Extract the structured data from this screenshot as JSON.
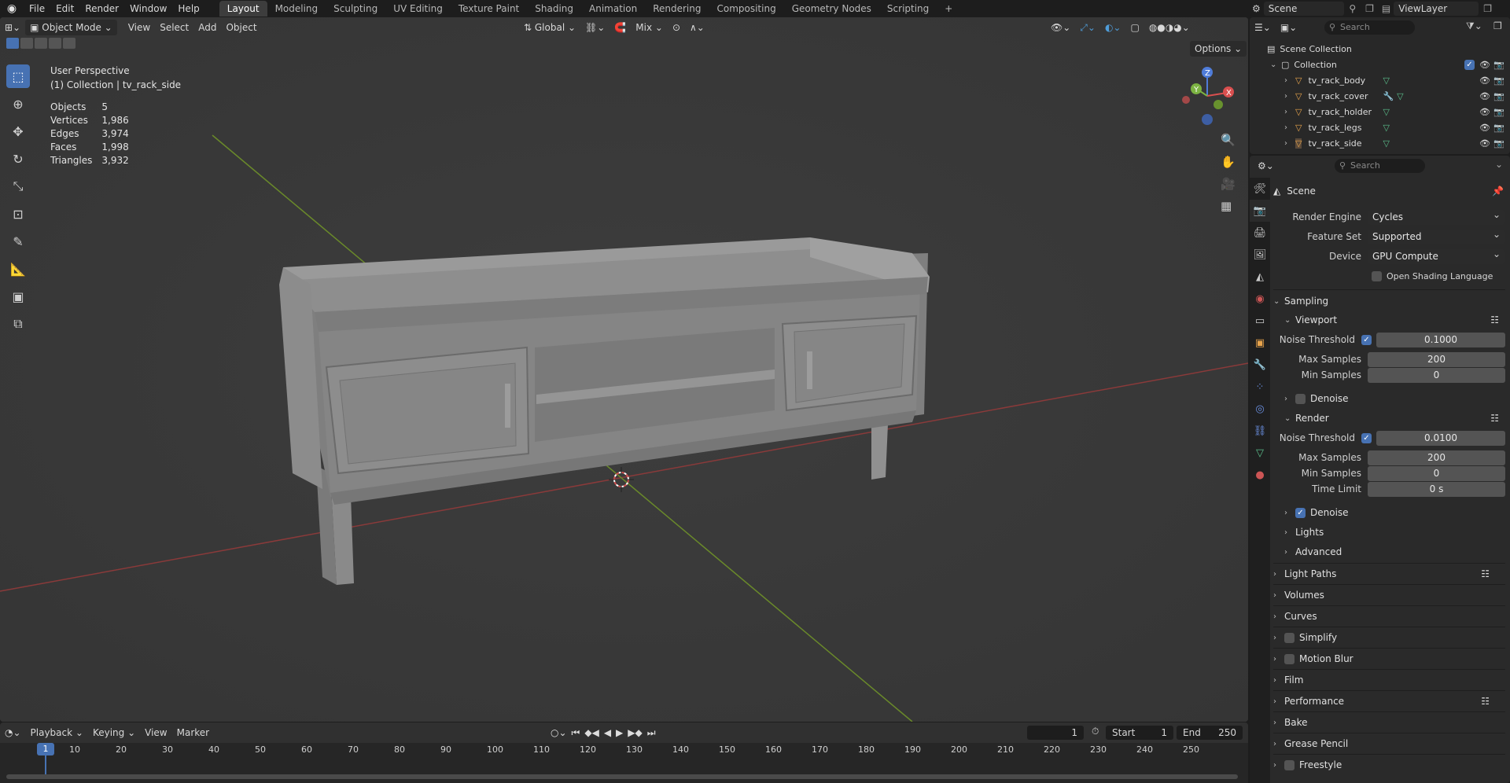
{
  "topbar": {
    "menus": [
      "File",
      "Edit",
      "Render",
      "Window",
      "Help"
    ],
    "workspaces": [
      "Layout",
      "Modeling",
      "Sculpting",
      "UV Editing",
      "Texture Paint",
      "Shading",
      "Animation",
      "Rendering",
      "Compositing",
      "Geometry Nodes",
      "Scripting",
      "+"
    ],
    "active_workspace": "Layout",
    "scene_label": "Scene",
    "viewlayer_label": "ViewLayer"
  },
  "viewport": {
    "mode": "Object Mode",
    "menus": [
      "View",
      "Select",
      "Add",
      "Object"
    ],
    "transform_orientation": "Global",
    "snap_mode": "Mix",
    "options_label": "Options",
    "view_name": "User Perspective",
    "collection_line": "(1) Collection | tv_rack_side",
    "stats": [
      {
        "label": "Objects",
        "value": "5"
      },
      {
        "label": "Vertices",
        "value": "1,986"
      },
      {
        "label": "Edges",
        "value": "3,974"
      },
      {
        "label": "Faces",
        "value": "1,998"
      },
      {
        "label": "Triangles",
        "value": "3,932"
      }
    ],
    "gizmo_labels": {
      "x": "X",
      "y": "Y",
      "z": "Z"
    }
  },
  "timeline": {
    "menus": [
      "Playback",
      "Keying",
      "View",
      "Marker"
    ],
    "current_frame": "1",
    "start_label": "Start",
    "start_value": "1",
    "end_label": "End",
    "end_value": "250",
    "ticks": [
      "1",
      "10",
      "20",
      "30",
      "40",
      "50",
      "60",
      "70",
      "80",
      "90",
      "100",
      "110",
      "120",
      "130",
      "140",
      "150",
      "160",
      "170",
      "180",
      "190",
      "200",
      "210",
      "220",
      "230",
      "240",
      "250"
    ]
  },
  "outliner": {
    "search_placeholder": "Search",
    "root": "Scene Collection",
    "collection": "Collection",
    "objects": [
      "tv_rack_body",
      "tv_rack_cover",
      "tv_rack_holder",
      "tv_rack_legs",
      "tv_rack_side"
    ],
    "selected_index": 4
  },
  "properties": {
    "search_placeholder": "Search",
    "context_title": "Scene",
    "render_engine_label": "Render Engine",
    "render_engine": "Cycles",
    "feature_set_label": "Feature Set",
    "feature_set": "Supported",
    "device_label": "Device",
    "device": "GPU Compute",
    "osl_label": "Open Shading Language",
    "sampling": "Sampling",
    "viewport_sub": "Viewport",
    "noise_threshold_label": "Noise Threshold",
    "vp_noise_threshold": "0.1000",
    "max_samples_label": "Max Samples",
    "vp_max_samples": "200",
    "min_samples_label": "Min Samples",
    "vp_min_samples": "0",
    "denoise_label": "Denoise",
    "render_sub": "Render",
    "r_noise_threshold": "0.0100",
    "r_max_samples": "200",
    "r_min_samples": "0",
    "time_limit_label": "Time Limit",
    "time_limit": "0 s",
    "lights": "Lights",
    "advanced": "Advanced",
    "panels": [
      "Light Paths",
      "Volumes",
      "Curves",
      "Simplify",
      "Motion Blur",
      "Film",
      "Performance",
      "Bake",
      "Grease Pencil",
      "Freestyle"
    ]
  }
}
